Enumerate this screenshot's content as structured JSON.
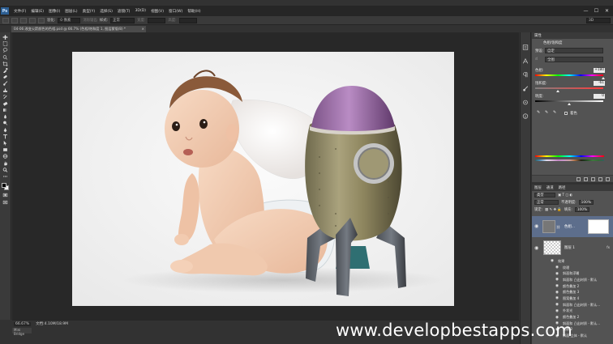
{
  "app": {
    "logo": "Ps"
  },
  "menubar": {
    "items": [
      "文件(F)",
      "编辑(E)",
      "图像(I)",
      "图层(L)",
      "类型(Y)",
      "选择(S)",
      "滤镜(T)",
      "3D(D)",
      "视图(V)",
      "窗口(W)",
      "帮助(H)"
    ],
    "controls": [
      "—",
      "☐",
      "✕"
    ]
  },
  "optionsbar": {
    "feather_label": "羽化:",
    "feather_value": "0 像素",
    "antialias_label": "消除锯齿",
    "style_label": "样式:",
    "style_value": "正常",
    "width_label": "宽度:",
    "height_label": "高度:",
    "right_value": "3D"
  },
  "document_tab": {
    "title": "04-06 改变火箭颜色的色相.psd @ 66.7% (色相/饱和度 1, 图层蒙版/8) *",
    "close": "×"
  },
  "statusbar": {
    "zoom": "66.67%",
    "doc_size": "文档:4.10M/18.9M",
    "mini_bridge": "Mini Bridge"
  },
  "adjustments": {
    "panel_title": "属性",
    "subtitle": "色相/饱和度",
    "preset_label": "预设:",
    "preset_value": "自定",
    "channel_value": "全图",
    "hue_label": "色相:",
    "hue_value": "+180",
    "saturation_label": "饱和度:",
    "saturation_value": "-61",
    "lightness_label": "明度:",
    "lightness_value": "0",
    "colorize_label": "着色"
  },
  "layers": {
    "tabs": [
      "图层",
      "通道",
      "路径"
    ],
    "filter_label": "类型",
    "blend_mode": "正常",
    "opacity_label": "不透明度:",
    "opacity_value": "100%",
    "lock_label": "锁定:",
    "fill_label": "填充:",
    "fill_value": "100%",
    "adj_layer_name": "色相...",
    "image_layer_name": "图层 1",
    "fx_badge": "fx",
    "effects_header": "效果",
    "effects": [
      "纹理",
      "斜面和浮雕",
      "斜面和 凸出材质 - 默认",
      "颜色叠加 2",
      "颜色叠加 3",
      "图案叠加 4",
      "斜面和 凸出材质 - 默认...",
      "外发光",
      "颜色叠加 2",
      "斜面和 凸出材质 - 默认...",
      "投影 2",
      "斜面 立体 - 默认"
    ]
  },
  "watermark": "www.developbestapps.com"
}
